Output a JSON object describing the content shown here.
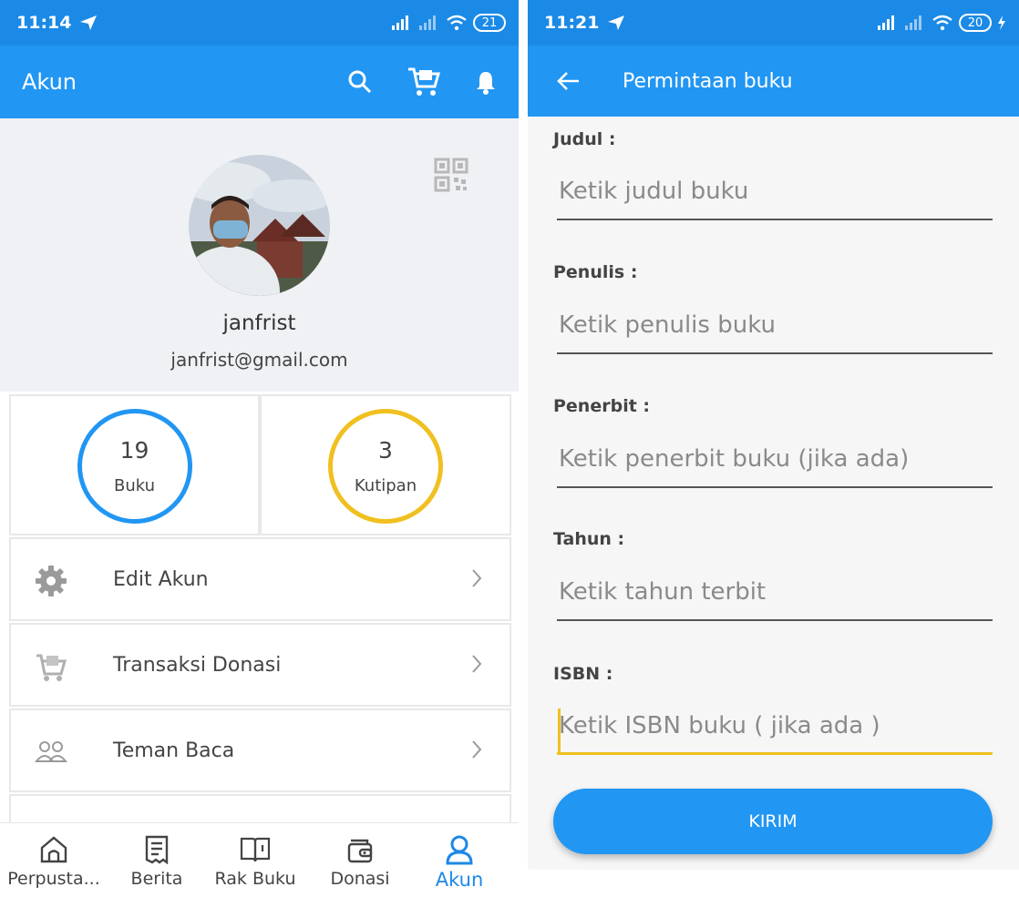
{
  "left": {
    "status_time": "11:14",
    "battery": "21",
    "appbar_title": "Akun",
    "user": {
      "name": "janfrist",
      "email": "janfrist@gmail.com"
    },
    "stats": [
      {
        "value": "19",
        "label": "Buku",
        "color": "#2196f3"
      },
      {
        "value": "3",
        "label": "Kutipan",
        "color": "#f0c020"
      }
    ],
    "menu": [
      {
        "label": "Edit Akun",
        "icon": "gear-icon"
      },
      {
        "label": "Transaksi Donasi",
        "icon": "cart-icon"
      },
      {
        "label": "Teman Baca",
        "icon": "people-icon"
      }
    ],
    "nav": [
      {
        "label": "Perpusta...",
        "icon": "home-icon"
      },
      {
        "label": "Berita",
        "icon": "news-icon"
      },
      {
        "label": "Rak Buku",
        "icon": "book-icon"
      },
      {
        "label": "Donasi",
        "icon": "wallet-icon"
      },
      {
        "label": "Akun",
        "icon": "user-icon",
        "active": true
      }
    ]
  },
  "right": {
    "status_time": "11:21",
    "battery": "20",
    "appbar_title": "Permintaan buku",
    "fields": [
      {
        "label": "Judul :",
        "placeholder": "Ketik judul buku"
      },
      {
        "label": "Penulis :",
        "placeholder": "Ketik penulis buku"
      },
      {
        "label": "Penerbit :",
        "placeholder": "Ketik penerbit buku (jika ada)"
      },
      {
        "label": "Tahun :",
        "placeholder": "Ketik tahun terbit"
      },
      {
        "label": "ISBN :",
        "placeholder": "Ketik ISBN buku ( jika ada )"
      }
    ],
    "submit_label": "KIRIM"
  },
  "colors": {
    "primary": "#2196f3",
    "status_bar": "#1b8ae6",
    "accent_yellow": "#f0c020"
  }
}
